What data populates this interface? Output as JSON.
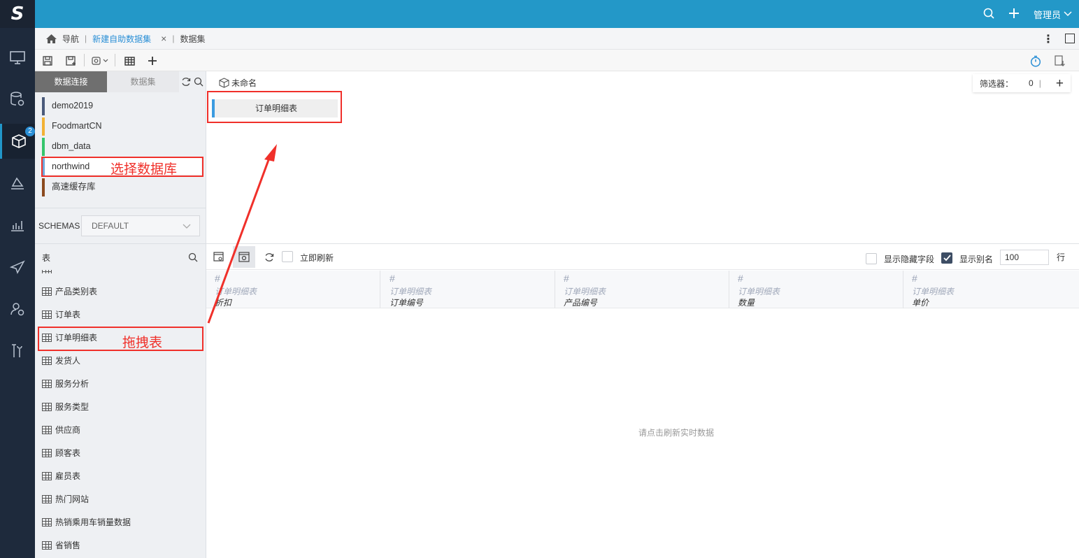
{
  "app": {
    "logo": "S"
  },
  "rail": {
    "badge_count": "2"
  },
  "topbar": {
    "user_label": "管理员"
  },
  "breadcrumb": {
    "home_label": "导航",
    "active_tab": "新建自助数据集",
    "close_symbol": "×",
    "dataset_label": "数据集"
  },
  "left": {
    "tab_connections": "数据连接",
    "tab_datasets": "数据集",
    "databases": [
      {
        "label": "demo2019",
        "color": "#4a5a7a"
      },
      {
        "label": "FoodmartCN",
        "color": "#f2b134"
      },
      {
        "label": "dbm_data",
        "color": "#35c56c"
      },
      {
        "label": "northwind",
        "color": "#6fa8dc"
      },
      {
        "label": "高速缓存库",
        "color": "#8b4a1e"
      }
    ],
    "schemas_label": "SCHEMAS",
    "schemas_value": "DEFAULT",
    "tables_label": "表",
    "tables": [
      "产品类别表",
      "订单表",
      "订单明细表",
      "发货人",
      "服务分析",
      "服务类型",
      "供应商",
      "顾客表",
      "雇员表",
      "热门网站",
      "热销乘用车销量数据",
      "省销售"
    ]
  },
  "canvas": {
    "dataset_name": "未命名",
    "filter_label": "筛选器：",
    "filter_count": "0",
    "node_label": "订单明细表"
  },
  "preview": {
    "auto_refresh_label": "立即刷新",
    "show_hidden_label": "显示隐藏字段",
    "show_alias_label": "显示别名",
    "row_count": "100",
    "rows_unit": "行",
    "columns": [
      {
        "type": "#",
        "table": "订单明细表",
        "name": "折扣"
      },
      {
        "type": "#",
        "table": "订单明细表",
        "name": "订单编号"
      },
      {
        "type": "#",
        "table": "订单明细表",
        "name": "产品编号"
      },
      {
        "type": "#",
        "table": "订单明细表",
        "name": "数量"
      },
      {
        "type": "#",
        "table": "订单明细表",
        "name": "单价"
      }
    ],
    "empty_message": "请点击刷新实时数据"
  },
  "annotations": {
    "select_db": "选择数据库",
    "drag_table": "拖拽表"
  }
}
